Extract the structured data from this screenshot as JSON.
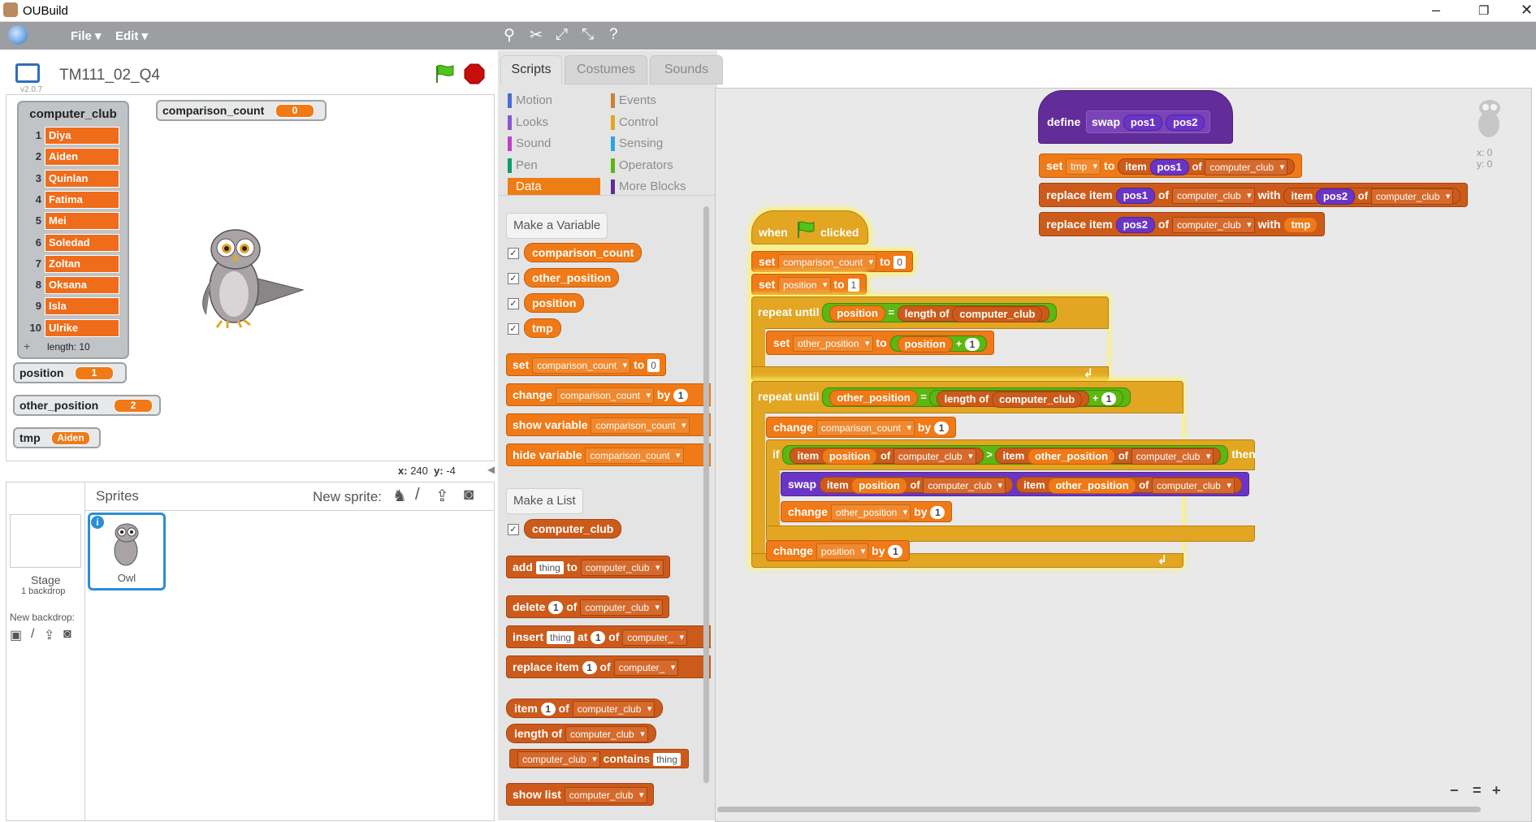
{
  "window": {
    "title": "OUBuild",
    "minimize": "–",
    "maximize": "❐",
    "close": "✕"
  },
  "menu": {
    "file": "File ▾",
    "edit": "Edit ▾",
    "version": "v2.0.7"
  },
  "project": {
    "title": "TM111_02_Q4"
  },
  "stage": {
    "list_watcher": {
      "title": "computer_club",
      "items": [
        "Diya",
        "Aiden",
        "Quinlan",
        "Fatima",
        "Mei",
        "Soledad",
        "Zoltan",
        "Oksana",
        "Isla",
        "Ulrike"
      ],
      "length_label": "length: 10",
      "add_symbol": "+"
    },
    "watchers": [
      {
        "label": "comparison_count",
        "value": "0"
      },
      {
        "label": "position",
        "value": "1"
      },
      {
        "label": "other_position",
        "value": "2"
      },
      {
        "label": "tmp",
        "value": "Aiden"
      }
    ],
    "coords": {
      "x_label": "x:",
      "x": "240",
      "y_label": "y:",
      "y": "-4"
    }
  },
  "sprites": {
    "header": "Sprites",
    "new_sprite": "New sprite:",
    "stage_label": "Stage",
    "backdrops": "1 backdrop",
    "new_backdrop": "New backdrop:",
    "owl_label": "Owl",
    "info": "i"
  },
  "tabs": [
    "Scripts",
    "Costumes",
    "Sounds"
  ],
  "categories": [
    {
      "label": "Motion",
      "color": "#4a6cd4"
    },
    {
      "label": "Events",
      "color": "#c88330"
    },
    {
      "label": "Looks",
      "color": "#8a55d7"
    },
    {
      "label": "Control",
      "color": "#e1a91a"
    },
    {
      "label": "Sound",
      "color": "#bb42c3"
    },
    {
      "label": "Sensing",
      "color": "#2ca5e2"
    },
    {
      "label": "Pen",
      "color": "#0e9a6c"
    },
    {
      "label": "Operators",
      "color": "#5cb712"
    },
    {
      "label": "Data",
      "color": "#ee7d16"
    },
    {
      "label": "More Blocks",
      "color": "#632d99"
    }
  ],
  "palette": {
    "make_variable": "Make a Variable",
    "variables": [
      "comparison_count",
      "other_position",
      "position",
      "tmp"
    ],
    "make_list": "Make a List",
    "list_name": "computer_club",
    "check": "✓",
    "words": {
      "set": "set",
      "to": "to",
      "change": "change",
      "by": "by",
      "show_variable": "show variable",
      "hide_variable": "hide variable",
      "add": "add",
      "thing": "thing",
      "delete": "delete",
      "of": "of",
      "insert": "insert",
      "at": "at",
      "replace_item": "replace item",
      "item": "item",
      "length_of": "length of",
      "contains": "contains",
      "show_list": "show list",
      "one": "1",
      "zero": "0",
      "computer_trunc": "computer_"
    }
  },
  "script": {
    "define": "define",
    "swap": "swap",
    "pos1": "pos1",
    "pos2": "pos2",
    "set": "set",
    "tmp": "tmp",
    "to": "to",
    "item": "item",
    "of": "of",
    "computer_club": "computer_club",
    "replace_item": "replace item",
    "with": "with",
    "when": "when",
    "clicked": "clicked",
    "comparison_count": "comparison_count",
    "zero": "0",
    "one": "1",
    "position": "position",
    "repeat_until": "repeat until",
    "eq": "=",
    "length_of": "length of",
    "other_position": "other_position",
    "plus": "+",
    "change": "change",
    "by": "by",
    "if": "if",
    "gt": ">",
    "then": "then",
    "loop_arrow": "↲"
  },
  "sprite_info": {
    "x": "x: 0",
    "y": "y: 0"
  },
  "zoom": {
    "out": "−",
    "reset": "=",
    "in": "+"
  }
}
